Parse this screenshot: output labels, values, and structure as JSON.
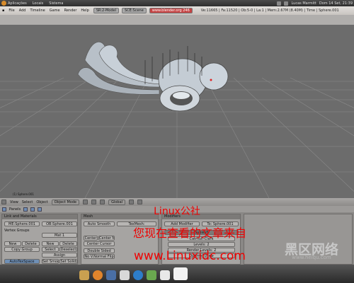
{
  "gnome_panel": {
    "menus": [
      "Aplicações",
      "Locais",
      "Sistema"
    ],
    "user": "Lucas Marmitt",
    "clock": "Dom 14 Set, 21:39"
  },
  "blender": {
    "menu": [
      "File",
      "Add",
      "Timeline",
      "Game",
      "Render",
      "Help"
    ],
    "screen": "SR:2-Model",
    "scene": "SCE:Scene",
    "url": "www.blender.org 246",
    "stats": "Ve:11665 | Fa:11520 | Ob:5-0 | La:1 | Mem:2.67M (8.40M) | Time | Sphere.001"
  },
  "viewport": {
    "object_label": "(1) Sphere.001"
  },
  "view_header": {
    "menus": [
      "View",
      "Select",
      "Object"
    ],
    "mode": "Object Mode",
    "orientation": "Global"
  },
  "buttons_window": {
    "panels_label": "Panels",
    "panel1": {
      "title": "Link and Materials",
      "me": "ME:Sphere.001",
      "ob": "OB:Sphere.001",
      "vertex_groups": "Vertex Groups",
      "material": "Mat 1",
      "new": "New",
      "delete": "Delete",
      "copy_group": "Copy Group",
      "select": "Select",
      "deselect": "Deselect",
      "assign": "Assign",
      "set_smooth": "Set Smooth",
      "set_solid": "Set Solid",
      "auto_tex": "AutoTexSpace"
    },
    "panel2": {
      "title": "Mesh",
      "auto_smooth": "Auto Smooth",
      "tex_mesh": "TexMesh:",
      "center": "Center",
      "center_new": "Center New",
      "center_cursor": "Center Cursor",
      "double_sided": "Double Sided",
      "no_vnormal_flip": "No V.Normal Flip"
    },
    "panel3": {
      "title": "Modifiers",
      "to": "To: Sphere.001",
      "add_modifier": "Add Modifier",
      "subsurf": "Subsurf",
      "catmull": "Catmull-Clark",
      "levels": "Levels: 2",
      "render_levels": "Render Levels: 2",
      "optimal": "Optimal Draw"
    }
  },
  "watermark": {
    "line1": "Linux公社",
    "line2": "您现在查看的文章来自",
    "line3": "www.Linuxidc.com",
    "site_cn": "黑区网络",
    "site_url": "www.heiqu.com"
  }
}
